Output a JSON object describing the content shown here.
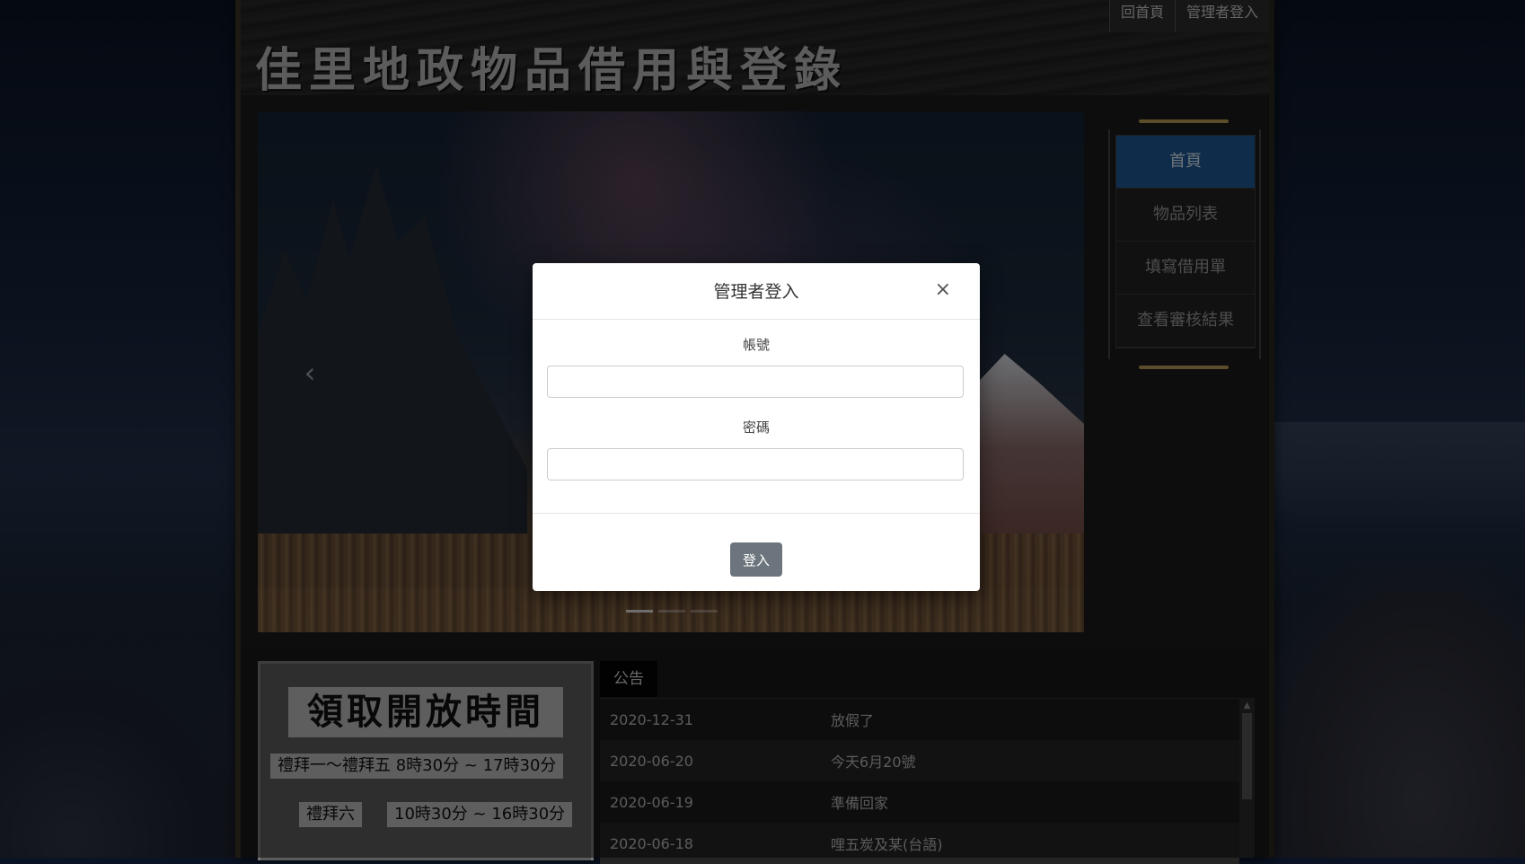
{
  "header": {
    "site_title": "佳里地政物品借用與登錄",
    "top_links": [
      "回首頁",
      "管理者登入"
    ]
  },
  "carousel": {
    "prev_icon": "chevron-left-icon",
    "prev_glyph": "‹"
  },
  "nav": {
    "items": [
      {
        "label": "首頁",
        "active": true
      },
      {
        "label": "物品列表",
        "active": false
      },
      {
        "label": "填寫借用單",
        "active": false
      },
      {
        "label": "查看審核結果",
        "active": false
      }
    ],
    "active_color": "#1e5a96"
  },
  "hours": {
    "title": "領取開放時間",
    "weekday": "禮拜一～禮拜五  8時30分 ~ 17時30分",
    "saturday_label": "禮拜六",
    "saturday_time": "10時30分 ~ 16時30分"
  },
  "announcements": {
    "tab_label": "公告",
    "rows": [
      {
        "date": "2020-12-31",
        "title": "放假了"
      },
      {
        "date": "2020-06-20",
        "title": "今天6月20號"
      },
      {
        "date": "2020-06-19",
        "title": "準備回家"
      },
      {
        "date": "2020-06-18",
        "title": "哩五炭及某(台語)"
      }
    ]
  },
  "modal": {
    "title": "管理者登入",
    "close_glyph": "×",
    "account_label": "帳號",
    "account_value": "",
    "password_label": "密碼",
    "password_value": "",
    "submit_label": "登入",
    "submit_color": "#6c757d"
  }
}
